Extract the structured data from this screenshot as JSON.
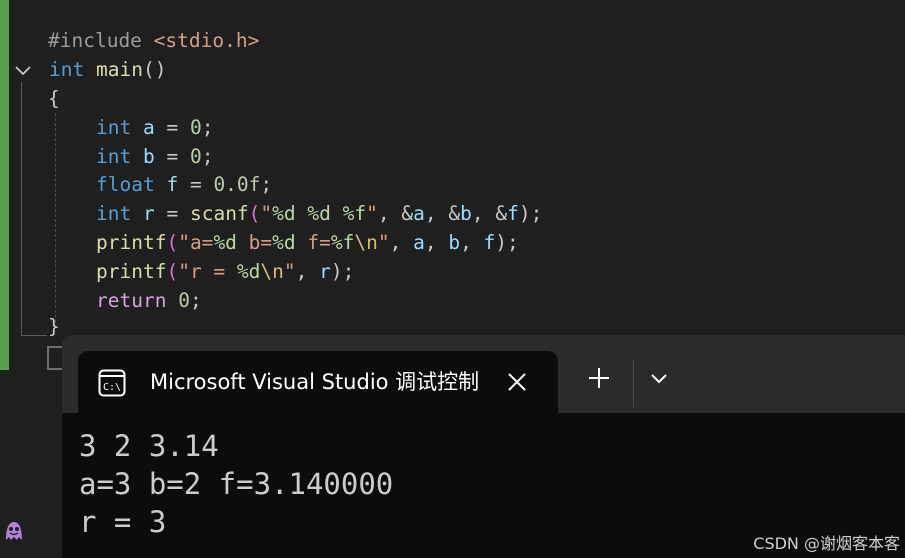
{
  "editor": {
    "line1": {
      "pre": "#include ",
      "inc": "<stdio.h>"
    },
    "line2": {
      "kw": "int",
      "sp": " ",
      "fn": "main",
      "paren": "()"
    },
    "line3": {
      "brace": "{"
    },
    "line4": {
      "kw": "int",
      "sp1": " ",
      "var": "a",
      "mid": " = ",
      "num": "0",
      "end": ";"
    },
    "line5": {
      "kw": "int",
      "sp1": " ",
      "var": "b",
      "mid": " = ",
      "num": "0",
      "end": ";"
    },
    "line6": {
      "kw": "float",
      "sp1": " ",
      "var": "f",
      "mid": " = ",
      "num": "0.0f",
      "end": ";"
    },
    "line7": {
      "kw": "int",
      "sp1": " ",
      "var1": "r",
      "eq": " = ",
      "fn": "scanf",
      "p1": "(",
      "q1": "\"",
      "fmt1": "%d",
      "s1": " ",
      "fmt2": "%d",
      "s2": " ",
      "fmt3": "%f",
      "q2": "\"",
      "c1": ", &",
      "var2": "a",
      "c2": ", &",
      "var3": "b",
      "c3": ", &",
      "var4": "f",
      "end": ");"
    },
    "line8": {
      "fn": "printf",
      "p1": "(",
      "q1": "\"a=",
      "fmt1": "%d",
      "s1": " b=",
      "fmt2": "%d",
      "s2": " f=",
      "fmt3": "%f",
      "esc": "\\n",
      "q2": "\"",
      "c1": ", ",
      "var1": "a",
      "c2": ", ",
      "var2": "b",
      "c3": ", ",
      "var3": "f",
      "end": ");"
    },
    "line9": {
      "fn": "printf",
      "p1": "(",
      "q1": "\"r = ",
      "fmt1": "%d",
      "esc": "\\n",
      "q2": "\"",
      "c1": ", ",
      "var1": "r",
      "end": ");"
    },
    "line10": {
      "kw": "return",
      "sp1": " ",
      "num": "0",
      "end": ";"
    },
    "line11": {
      "brace": "}"
    }
  },
  "terminal": {
    "tab_title": "Microsoft Visual Studio 调试控制台",
    "output": [
      "3 2 3.14",
      "a=3 b=2 f=3.140000",
      "r = 3"
    ]
  },
  "watermark": "CSDN @谢烟客本客",
  "icons": {
    "tab": "console-app-icon",
    "close": "close-icon",
    "add": "plus-icon",
    "dropdown": "chevron-down-icon",
    "fold": "chevron-down-icon",
    "copilot": "ghost-bot-icon"
  },
  "colors": {
    "editor_bg": "#1f1f1f",
    "change_bar": "#58a04b",
    "keyword": "#569cd6",
    "function": "#dcdcaa",
    "variable": "#9cdcfe",
    "number": "#b5cea8",
    "string": "#d69d85",
    "terminal_bg": "#0c0c0c"
  }
}
